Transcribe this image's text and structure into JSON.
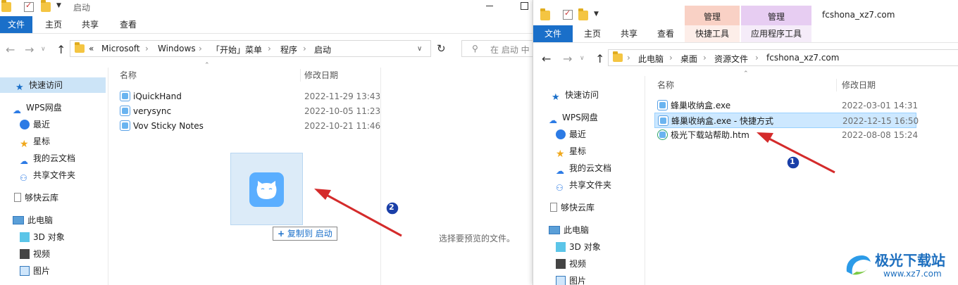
{
  "left_window": {
    "title": "启动",
    "ribbon_tabs": [
      "文件",
      "主页",
      "共享",
      "查看"
    ],
    "breadcrumb": [
      "«",
      "Microsoft",
      "Windows",
      "「开始」菜单",
      "程序",
      "启动"
    ],
    "search_placeholder": "在 启动 中",
    "nav": [
      "快速访问",
      "WPS网盘",
      "最近",
      "星标",
      "我的云文档",
      "共享文件夹",
      "够快云库",
      "此电脑",
      "3D 对象",
      "视频",
      "图片"
    ],
    "columns": {
      "name": "名称",
      "date": "修改日期"
    },
    "files": [
      {
        "name": "iQuickHand",
        "date": "2022-11-29 13:43"
      },
      {
        "name": "verysync",
        "date": "2022-10-05 11:23"
      },
      {
        "name": "Vov Sticky Notes",
        "date": "2022-10-21 11:46"
      }
    ],
    "preview_text": "选择要预览的文件。"
  },
  "drag": {
    "tooltip_plus": "+",
    "tooltip_text": "复制到 启动"
  },
  "right_window": {
    "title": "fcshona_xz7.com",
    "ctx_heads": [
      "管理",
      "管理"
    ],
    "ctx_tabs": [
      "快捷工具",
      "应用程序工具"
    ],
    "ribbon_tabs": [
      "文件",
      "主页",
      "共享",
      "查看"
    ],
    "breadcrumb": [
      "此电脑",
      "桌面",
      "资源文件",
      "fcshona_xz7.com"
    ],
    "nav": [
      "快速访问",
      "WPS网盘",
      "最近",
      "星标",
      "我的云文档",
      "共享文件夹",
      "够快云库",
      "此电脑",
      "3D 对象",
      "视频",
      "图片"
    ],
    "columns": {
      "name": "名称",
      "date": "修改日期"
    },
    "files": [
      {
        "name": "蜂巢收纳盒.exe",
        "date": "2022-03-01 14:31"
      },
      {
        "name": "蜂巢收纳盒.exe - 快捷方式",
        "date": "2022-12-15 16:50"
      },
      {
        "name": "极光下载站帮助.htm",
        "date": "2022-08-08 15:24"
      }
    ]
  },
  "badges": [
    "1",
    "2"
  ],
  "watermark": {
    "text": "极光下载站",
    "url": "www.xz7.com"
  },
  "colors": {
    "accent": "#1a6fc9",
    "arrow": "#d42b2b",
    "selected": "#cde8ff",
    "ctx_pink": "#f9d1c5",
    "ctx_purple": "#e7cdf2"
  }
}
